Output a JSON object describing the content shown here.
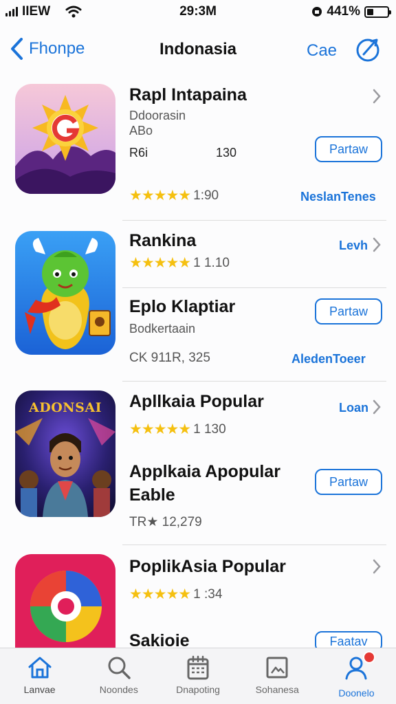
{
  "colors": {
    "accent": "#1a73d9",
    "star": "#f5c010",
    "badge": "#e53935"
  },
  "status_bar": {
    "carrier": "IIEW",
    "time": "29:3M",
    "battery": "441%"
  },
  "nav": {
    "back_label": "Fhonpe",
    "title": "Indonasia",
    "action_label": "Cae"
  },
  "apps": [
    {
      "title": "Rapl Intapaina",
      "subtitle": "Ddoorasin",
      "subtitle2": "ABo",
      "meta_left": "R6i",
      "meta_right": "130",
      "rating_stars": "★★★★★",
      "rating_text": "1:90",
      "get_label": "Partaw",
      "link_label": "NeslanTenes"
    },
    {
      "header": "Rankina",
      "header_link": "Levh",
      "header_rating_stars": "★★★★★",
      "header_rating_text": "1 1.10",
      "title": "Eplo Klaptiar",
      "subtitle": "Bodkertaain",
      "meta_left": "CK 911R, 325",
      "get_label": "Partaw",
      "link_label": "AledenToeer"
    },
    {
      "icon_text": "ADONSAI",
      "header": "Apllkaia Popular",
      "header_link": "Loan",
      "header_rating_stars": "★★★★★",
      "header_rating_text": "1 130",
      "title": "Applkaia Apopular",
      "title2": "Eable",
      "meta_left": "TR★ 12,279",
      "get_label": "Partaw"
    },
    {
      "header": "PoplikAsia Popular",
      "header_rating_stars": "★★★★★",
      "header_rating_text": "1 :34",
      "title": "Sakioie",
      "get_label": "Faatav"
    }
  ],
  "tabs": [
    {
      "label": "Lanvae",
      "icon": "home-icon"
    },
    {
      "label": "Noondes",
      "icon": "search-icon"
    },
    {
      "label": "Dnapoting",
      "icon": "calendar-icon"
    },
    {
      "label": "Sohanesa",
      "icon": "image-icon"
    },
    {
      "label": "Doonelo",
      "icon": "profile-icon"
    }
  ]
}
